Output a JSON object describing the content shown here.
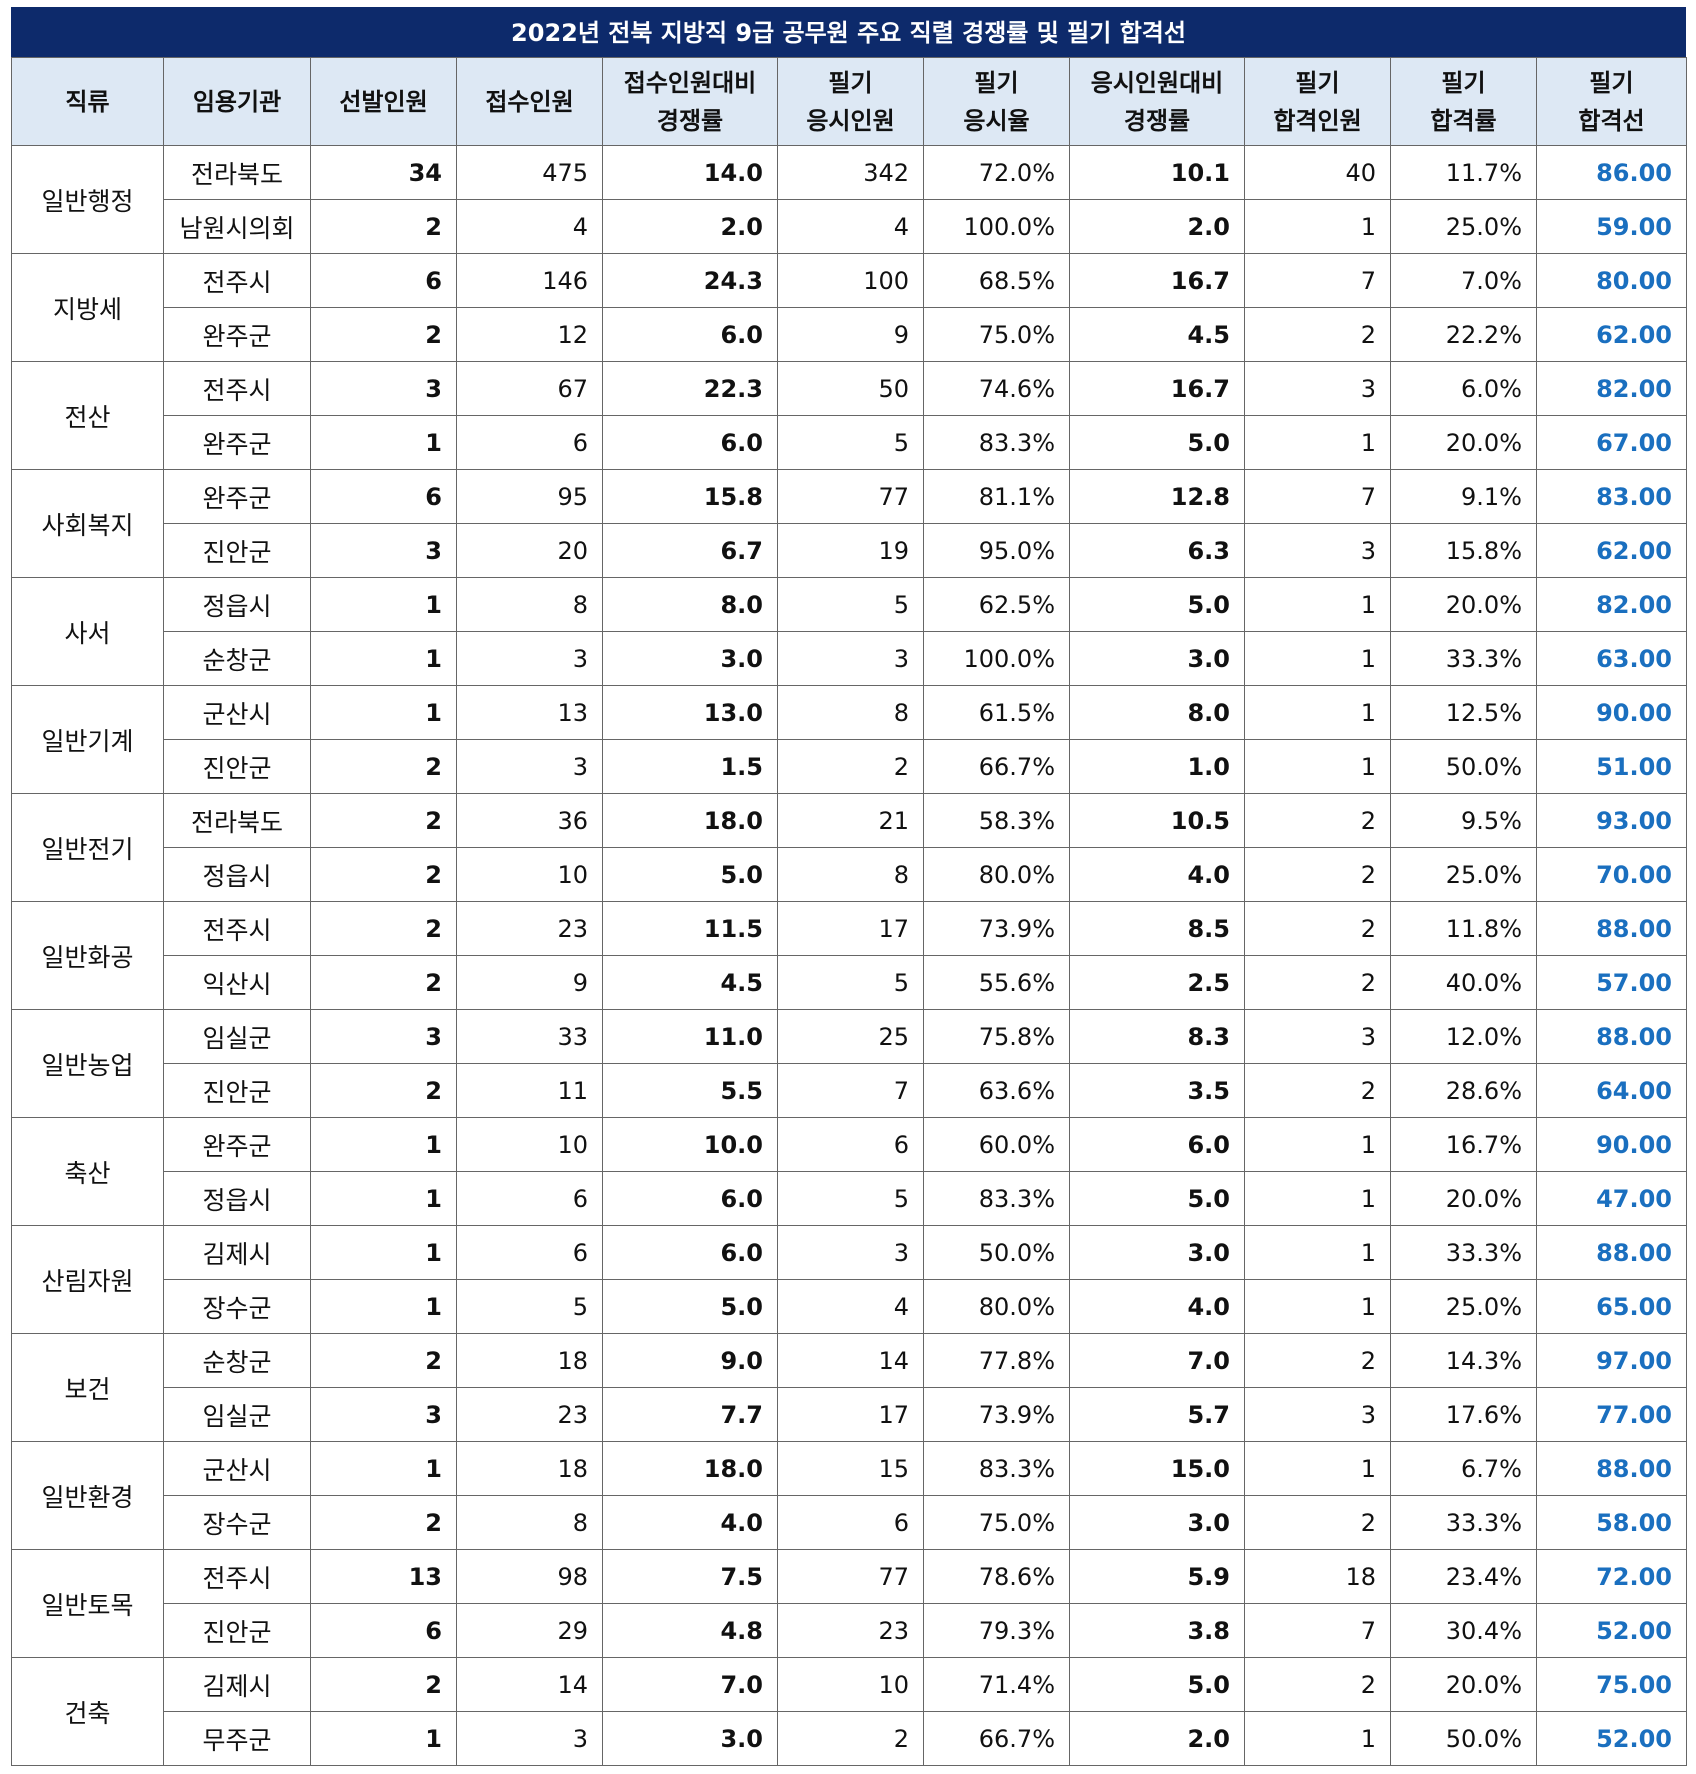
{
  "title": "2022년 전북 지방직 9급 공무원 주요 직렬 경쟁률 및 필기 합격선",
  "colors": {
    "title_bg": "#0d2a6b",
    "header_bg": "#dde8f4",
    "passline_text": "#1a6fbf"
  },
  "headers": [
    [
      "직류"
    ],
    [
      "임용기관"
    ],
    [
      "선발인원"
    ],
    [
      "접수인원"
    ],
    [
      "접수인원대비",
      "경쟁률"
    ],
    [
      "필기",
      "응시인원"
    ],
    [
      "필기",
      "응시율"
    ],
    [
      "응시인원대비",
      "경쟁률"
    ],
    [
      "필기",
      "합격인원"
    ],
    [
      "필기",
      "합격률"
    ],
    [
      "필기",
      "합격선"
    ]
  ],
  "groups": [
    {
      "category": "일반행정",
      "rows": [
        [
          "전라북도",
          "34",
          "475",
          "14.0",
          "342",
          "72.0%",
          "10.1",
          "40",
          "11.7%",
          "86.00"
        ],
        [
          "남원시의회",
          "2",
          "4",
          "2.0",
          "4",
          "100.0%",
          "2.0",
          "1",
          "25.0%",
          "59.00"
        ]
      ]
    },
    {
      "category": "지방세",
      "rows": [
        [
          "전주시",
          "6",
          "146",
          "24.3",
          "100",
          "68.5%",
          "16.7",
          "7",
          "7.0%",
          "80.00"
        ],
        [
          "완주군",
          "2",
          "12",
          "6.0",
          "9",
          "75.0%",
          "4.5",
          "2",
          "22.2%",
          "62.00"
        ]
      ]
    },
    {
      "category": "전산",
      "rows": [
        [
          "전주시",
          "3",
          "67",
          "22.3",
          "50",
          "74.6%",
          "16.7",
          "3",
          "6.0%",
          "82.00"
        ],
        [
          "완주군",
          "1",
          "6",
          "6.0",
          "5",
          "83.3%",
          "5.0",
          "1",
          "20.0%",
          "67.00"
        ]
      ]
    },
    {
      "category": "사회복지",
      "rows": [
        [
          "완주군",
          "6",
          "95",
          "15.8",
          "77",
          "81.1%",
          "12.8",
          "7",
          "9.1%",
          "83.00"
        ],
        [
          "진안군",
          "3",
          "20",
          "6.7",
          "19",
          "95.0%",
          "6.3",
          "3",
          "15.8%",
          "62.00"
        ]
      ]
    },
    {
      "category": "사서",
      "rows": [
        [
          "정읍시",
          "1",
          "8",
          "8.0",
          "5",
          "62.5%",
          "5.0",
          "1",
          "20.0%",
          "82.00"
        ],
        [
          "순창군",
          "1",
          "3",
          "3.0",
          "3",
          "100.0%",
          "3.0",
          "1",
          "33.3%",
          "63.00"
        ]
      ]
    },
    {
      "category": "일반기계",
      "rows": [
        [
          "군산시",
          "1",
          "13",
          "13.0",
          "8",
          "61.5%",
          "8.0",
          "1",
          "12.5%",
          "90.00"
        ],
        [
          "진안군",
          "2",
          "3",
          "1.5",
          "2",
          "66.7%",
          "1.0",
          "1",
          "50.0%",
          "51.00"
        ]
      ]
    },
    {
      "category": "일반전기",
      "rows": [
        [
          "전라북도",
          "2",
          "36",
          "18.0",
          "21",
          "58.3%",
          "10.5",
          "2",
          "9.5%",
          "93.00"
        ],
        [
          "정읍시",
          "2",
          "10",
          "5.0",
          "8",
          "80.0%",
          "4.0",
          "2",
          "25.0%",
          "70.00"
        ]
      ]
    },
    {
      "category": "일반화공",
      "rows": [
        [
          "전주시",
          "2",
          "23",
          "11.5",
          "17",
          "73.9%",
          "8.5",
          "2",
          "11.8%",
          "88.00"
        ],
        [
          "익산시",
          "2",
          "9",
          "4.5",
          "5",
          "55.6%",
          "2.5",
          "2",
          "40.0%",
          "57.00"
        ]
      ]
    },
    {
      "category": "일반농업",
      "rows": [
        [
          "임실군",
          "3",
          "33",
          "11.0",
          "25",
          "75.8%",
          "8.3",
          "3",
          "12.0%",
          "88.00"
        ],
        [
          "진안군",
          "2",
          "11",
          "5.5",
          "7",
          "63.6%",
          "3.5",
          "2",
          "28.6%",
          "64.00"
        ]
      ]
    },
    {
      "category": "축산",
      "rows": [
        [
          "완주군",
          "1",
          "10",
          "10.0",
          "6",
          "60.0%",
          "6.0",
          "1",
          "16.7%",
          "90.00"
        ],
        [
          "정읍시",
          "1",
          "6",
          "6.0",
          "5",
          "83.3%",
          "5.0",
          "1",
          "20.0%",
          "47.00"
        ]
      ]
    },
    {
      "category": "산림자원",
      "rows": [
        [
          "김제시",
          "1",
          "6",
          "6.0",
          "3",
          "50.0%",
          "3.0",
          "1",
          "33.3%",
          "88.00"
        ],
        [
          "장수군",
          "1",
          "5",
          "5.0",
          "4",
          "80.0%",
          "4.0",
          "1",
          "25.0%",
          "65.00"
        ]
      ]
    },
    {
      "category": "보건",
      "rows": [
        [
          "순창군",
          "2",
          "18",
          "9.0",
          "14",
          "77.8%",
          "7.0",
          "2",
          "14.3%",
          "97.00"
        ],
        [
          "임실군",
          "3",
          "23",
          "7.7",
          "17",
          "73.9%",
          "5.7",
          "3",
          "17.6%",
          "77.00"
        ]
      ]
    },
    {
      "category": "일반환경",
      "rows": [
        [
          "군산시",
          "1",
          "18",
          "18.0",
          "15",
          "83.3%",
          "15.0",
          "1",
          "6.7%",
          "88.00"
        ],
        [
          "장수군",
          "2",
          "8",
          "4.0",
          "6",
          "75.0%",
          "3.0",
          "2",
          "33.3%",
          "58.00"
        ]
      ]
    },
    {
      "category": "일반토목",
      "rows": [
        [
          "전주시",
          "13",
          "98",
          "7.5",
          "77",
          "78.6%",
          "5.9",
          "18",
          "23.4%",
          "72.00"
        ],
        [
          "진안군",
          "6",
          "29",
          "4.8",
          "23",
          "79.3%",
          "3.8",
          "7",
          "30.4%",
          "52.00"
        ]
      ]
    },
    {
      "category": "건축",
      "rows": [
        [
          "김제시",
          "2",
          "14",
          "7.0",
          "10",
          "71.4%",
          "5.0",
          "2",
          "20.0%",
          "75.00"
        ],
        [
          "무주군",
          "1",
          "3",
          "3.0",
          "2",
          "66.7%",
          "2.0",
          "1",
          "50.0%",
          "52.00"
        ]
      ]
    }
  ]
}
